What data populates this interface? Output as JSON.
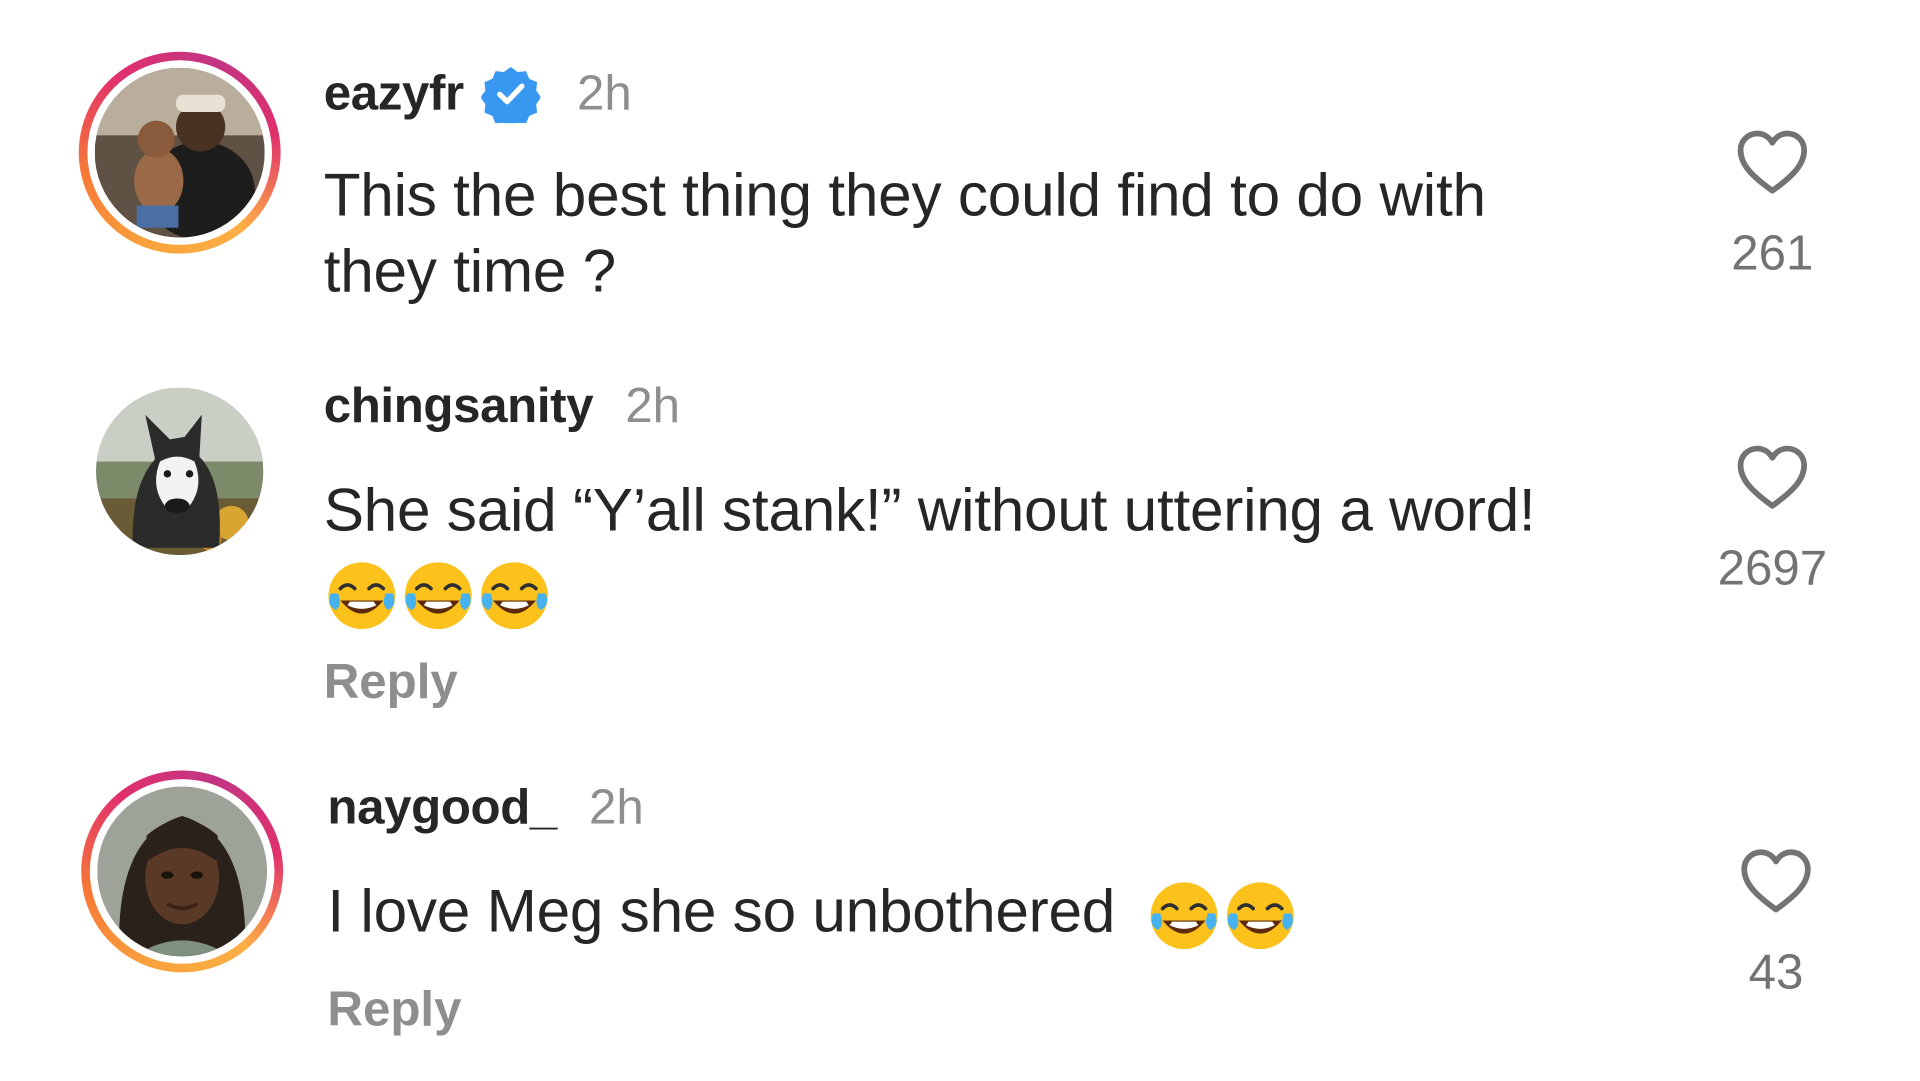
{
  "comments": [
    {
      "username": "eazyfr",
      "verified": true,
      "time": "2h",
      "text_line1": "This the best thing they could find to do with",
      "text_line2": "they time ?",
      "emoji_count": 0,
      "reply": "",
      "likes": "261",
      "avatar_ring": true
    },
    {
      "username": "chingsanity",
      "verified": false,
      "time": "2h",
      "text_line1": "She said “Y’all stank!” without uttering a word!",
      "text_line2": "",
      "emoji_count": 3,
      "reply": "Reply",
      "likes": "2697",
      "avatar_ring": false
    },
    {
      "username": "naygood_",
      "verified": false,
      "time": "2h",
      "text_line1": "I love Meg she so unbothered",
      "text_line2": "",
      "emoji_count": 2,
      "reply": "Reply",
      "likes": "43",
      "avatar_ring": true
    }
  ],
  "icons": {
    "like": "heart-outline-icon",
    "verified": "verified-badge-icon",
    "emoji": "face-with-tears-of-joy-emoji"
  },
  "colors": {
    "text": "#262626",
    "secondary": "#8e8e8e",
    "verified_blue": "#3897f0"
  }
}
